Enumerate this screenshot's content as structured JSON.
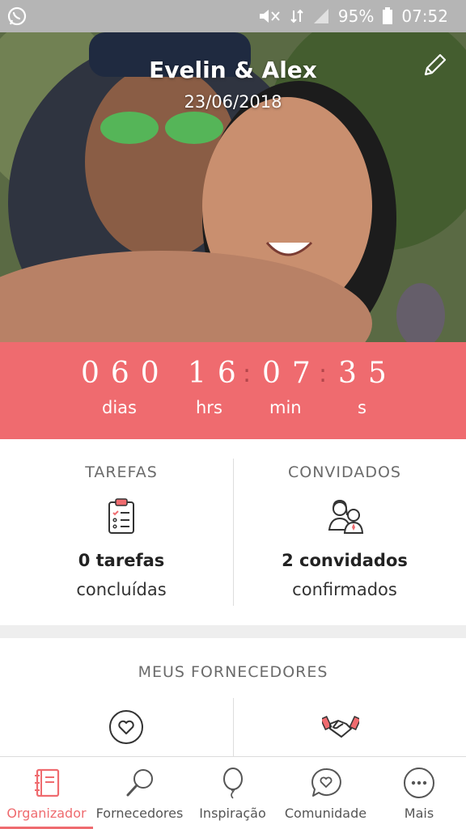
{
  "status_bar": {
    "battery": "95%",
    "time": "07:52",
    "icons": [
      "whatsapp-icon",
      "mute-icon",
      "network-icon",
      "signal-icon",
      "battery-icon"
    ]
  },
  "hero": {
    "title": "Evelin & Alex",
    "date": "23/06/2018",
    "edit_icon": "pencil-icon"
  },
  "countdown": {
    "days": "060",
    "hours": "16",
    "minutes": "07",
    "seconds": "35",
    "separator": ":",
    "labels": {
      "days": "dias",
      "hours": "hrs",
      "minutes": "min",
      "seconds": "s"
    },
    "background_color": "#ef6b6f"
  },
  "tasks": {
    "title": "TAREFAS",
    "count_text": "0 tarefas",
    "status_text": "concluídas",
    "icon": "clipboard-checklist-icon"
  },
  "guests": {
    "title": "CONVIDADOS",
    "count_text": "2 convidados",
    "status_text": "confirmados",
    "icon": "couple-icon"
  },
  "vendors": {
    "title": "MEUS FORNECEDORES",
    "icons": [
      "heart-circle-icon",
      "handshake-icon"
    ]
  },
  "bottom_nav": {
    "accent_color": "#ef6b6f",
    "items": [
      {
        "label": "Organizador",
        "icon": "notebook-icon",
        "active": true
      },
      {
        "label": "Fornecedores",
        "icon": "magnifier-icon",
        "active": false
      },
      {
        "label": "Inspiração",
        "icon": "balloon-icon",
        "active": false
      },
      {
        "label": "Comunidade",
        "icon": "chat-heart-icon",
        "active": false
      },
      {
        "label": "Mais",
        "icon": "more-dots-icon",
        "active": false
      }
    ]
  }
}
